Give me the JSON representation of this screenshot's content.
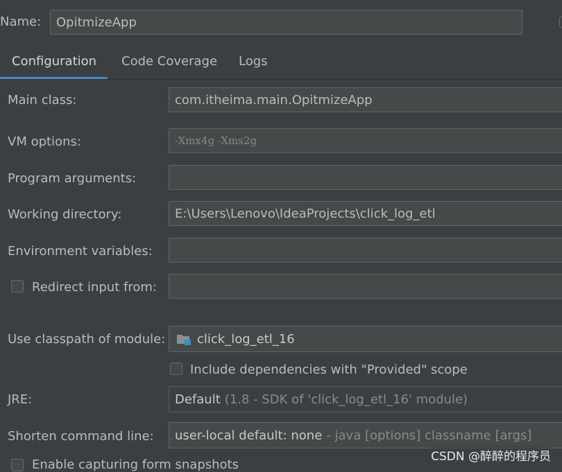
{
  "name": {
    "label": "Name:",
    "value": "OpitmizeApp"
  },
  "tabs": [
    {
      "label": "Configuration",
      "active": true
    },
    {
      "label": "Code Coverage",
      "active": false
    },
    {
      "label": "Logs",
      "active": false
    }
  ],
  "form": {
    "main_class": {
      "label": "Main class:",
      "value": "com.itheima.main.OpitmizeApp"
    },
    "vm_options": {
      "label": "VM options:",
      "value": "-Xmx4g -Xms2g"
    },
    "program_arguments": {
      "label": "Program arguments:",
      "value": ""
    },
    "working_directory": {
      "label": "Working directory:",
      "value": "E:\\Users\\Lenovo\\IdeaProjects\\click_log_etl"
    },
    "environment_variables": {
      "label": "Environment variables:",
      "value": ""
    },
    "redirect_input": {
      "label": "Redirect input from:",
      "checked": false,
      "value": ""
    },
    "classpath_module": {
      "label": "Use classpath of module:",
      "value": "click_log_etl_16",
      "icon": "module-folder-icon"
    },
    "include_provided": {
      "label": "Include dependencies with \"Provided\" scope",
      "checked": false
    },
    "jre": {
      "label": "JRE:",
      "value": "Default",
      "hint": "(1.8 - SDK of 'click_log_etl_16' module)"
    },
    "shorten_command_line": {
      "label": "Shorten command line:",
      "value": "user-local default: none",
      "hint": "- java [options] classname [args]"
    },
    "enable_capturing": {
      "label": "Enable capturing form snapshots",
      "checked": false
    }
  },
  "watermark": "CSDN @醉醉的程序员",
  "colors": {
    "background": "#3c3f41",
    "accent": "#4a88c7",
    "field_bg": "#45494a",
    "border": "#646464"
  }
}
